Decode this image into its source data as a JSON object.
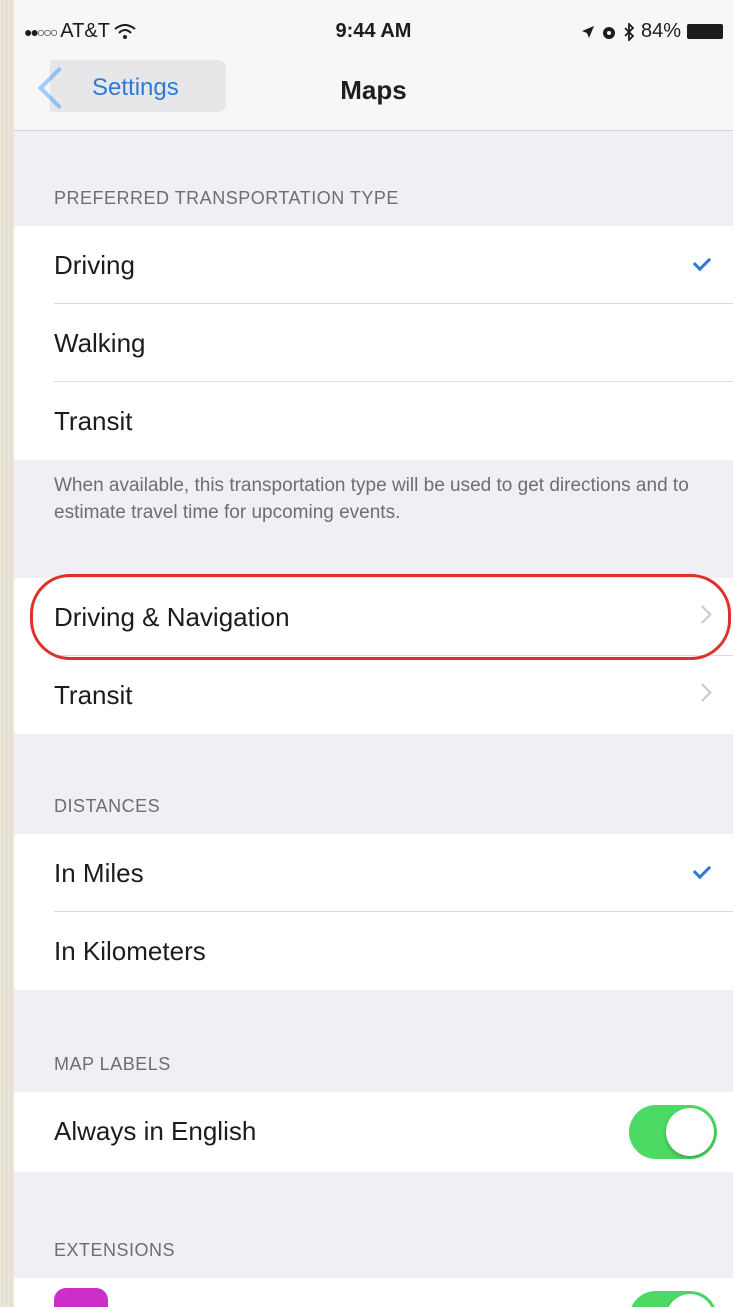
{
  "status_bar": {
    "signal_dots": "●●○○○",
    "carrier": "AT&T",
    "time": "9:44 AM",
    "battery_percent": "84%"
  },
  "nav": {
    "back_label": "Settings",
    "title": "Maps"
  },
  "sections": {
    "transport_header": "PREFERRED TRANSPORTATION TYPE",
    "transport_items": [
      "Driving",
      "Walking",
      "Transit"
    ],
    "transport_selected": "Driving",
    "transport_footer": "When available, this transportation type will be used to get directions and to estimate travel time for upcoming events.",
    "nav_items": [
      "Driving & Navigation",
      "Transit"
    ],
    "distances_header": "DISTANCES",
    "distance_items": [
      "In Miles",
      "In Kilometers"
    ],
    "distance_selected": "In Miles",
    "map_labels_header": "MAP LABELS",
    "map_labels_item": "Always in English",
    "map_labels_on": true,
    "extensions_header": "EXTENSIONS"
  },
  "colors": {
    "accent": "#2c7ad6",
    "toggle_on": "#4cd964",
    "highlight_ring": "#e0302c",
    "extension_icon": "#cc2fc7"
  },
  "icons": {
    "signal": "signal-dots-icon",
    "wifi": "wifi-icon",
    "location": "location-arrow-icon",
    "alarm": "alarm-icon",
    "bluetooth": "bluetooth-icon",
    "battery": "battery-icon",
    "check": "checkmark-icon",
    "chevron": "chevron-right-icon"
  }
}
